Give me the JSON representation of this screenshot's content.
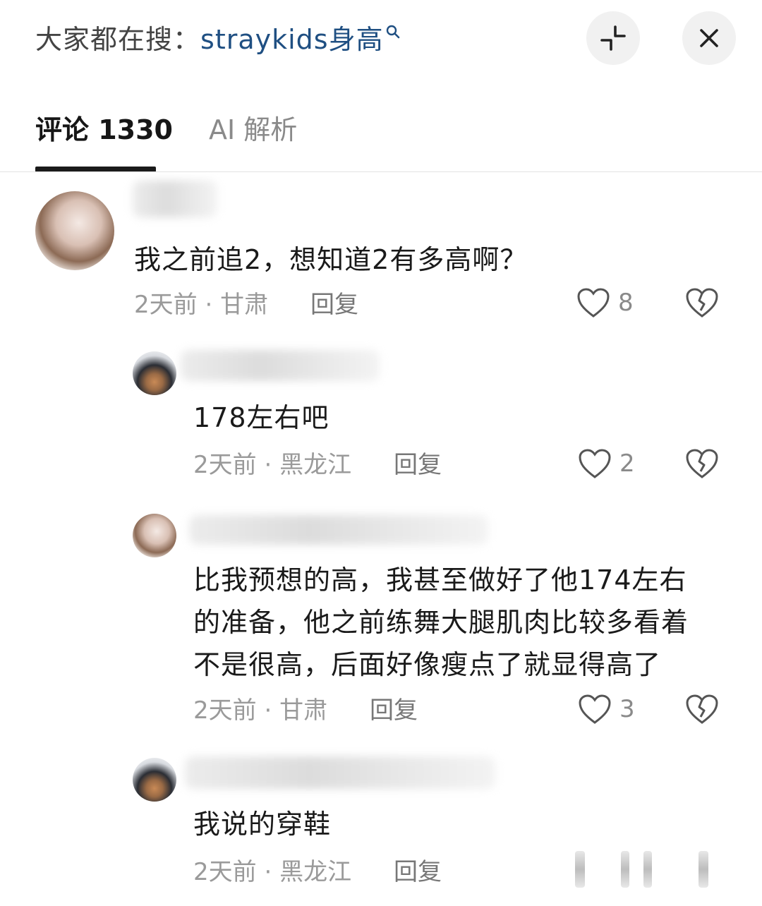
{
  "header": {
    "search_prefix": "大家都在搜：",
    "search_term": "straykids身高",
    "search_hint_icon": "magnifier-icon",
    "expand_icon": "collapse-arrows-icon",
    "close_icon": "close-icon"
  },
  "tabs": [
    {
      "label": "评论 1330",
      "active": true
    },
    {
      "label": "AI 解析",
      "active": false
    }
  ],
  "comments": [
    {
      "text": "我之前追2，想知道2有多高啊？",
      "time": "2天前",
      "location": "甘肃",
      "reply_label": "回复",
      "likes": "8"
    },
    {
      "text": "178左右吧",
      "time": "2天前",
      "location": "黑龙江",
      "reply_label": "回复",
      "likes": "2"
    },
    {
      "text": [
        "比我预想的高，我甚至做好了他174左右",
        "的准备，他之前练舞大腿肌肉比较多看着",
        "不是很高，后面好像瘦点了就显得高了"
      ],
      "time": "2天前",
      "location": "甘肃",
      "reply_label": "回复",
      "likes": "3"
    },
    {
      "text": "我说的穿鞋",
      "time": "2天前",
      "location": "黑龙江",
      "reply_label": "回复"
    }
  ],
  "meta_separator": "·"
}
